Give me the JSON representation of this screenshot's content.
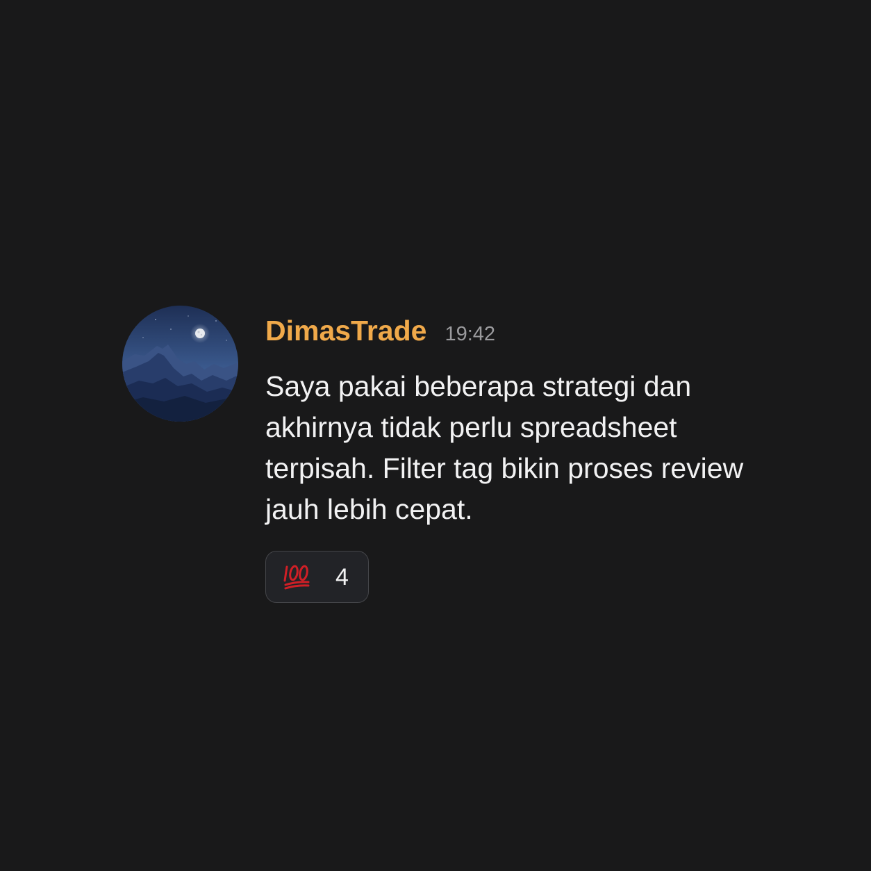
{
  "message": {
    "author": {
      "name": "DimasTrade",
      "name_color": "#f0a94a",
      "avatar": "night-mountain-moon-avatar"
    },
    "timestamp": "19:42",
    "text": "Saya pakai beberapa strategi dan akhirnya tidak perlu spreadsheet terpisah. Filter tag bikin proses review jauh lebih cepat.",
    "reactions": [
      {
        "emoji": "hundred-points-icon",
        "count": "4"
      }
    ]
  },
  "colors": {
    "background": "#19191a",
    "text": "#f2f2f3",
    "timestamp": "#9a9a9d",
    "reaction_bg": "#222327",
    "reaction_border": "#45464a",
    "hundred_red": "#d01f26"
  }
}
